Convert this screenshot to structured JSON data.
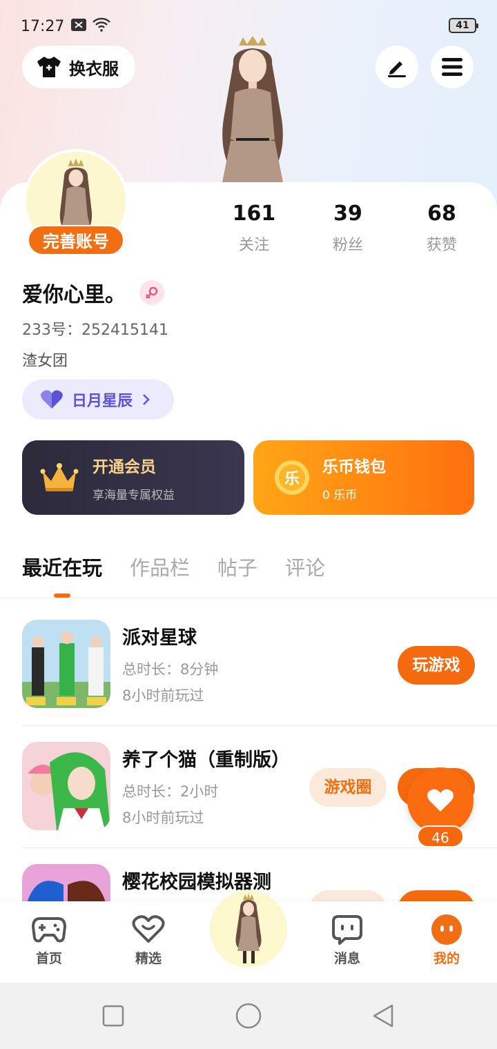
{
  "status": {
    "time": "17:27",
    "battery": "41"
  },
  "header": {
    "dress_label": "换衣服"
  },
  "profile": {
    "complete_label": "完善账号",
    "name": "爱你心里。",
    "uid_text": "233号：252415141",
    "bio": "渣女团",
    "group_label": "日月星辰"
  },
  "stats": [
    {
      "value": "161",
      "label": "关注"
    },
    {
      "value": "39",
      "label": "粉丝"
    },
    {
      "value": "68",
      "label": "获赞"
    }
  ],
  "promo": {
    "vip_title": "开通会员",
    "vip_sub": "享海量专属权益",
    "wallet_title": "乐币钱包",
    "wallet_sub": "0 乐币",
    "coin_glyph": "乐"
  },
  "tabs": [
    "最近在玩",
    "作品栏",
    "帖子",
    "评论"
  ],
  "games": [
    {
      "name": "派对星球",
      "duration": "总时长：8分钟",
      "last_played": "8小时前玩过",
      "play_label": "玩游戏"
    },
    {
      "name": "养了个猫（重制版）",
      "duration": "总时长：2小时",
      "last_played": "8小时前玩过",
      "circle_label": "游戏圈"
    },
    {
      "name": "樱花校园模拟器测"
    }
  ],
  "like_count": "46",
  "nav": {
    "home": "首页",
    "featured": "精选",
    "messages": "消息",
    "mine": "我的"
  },
  "colors": {
    "accent": "#f26e12",
    "vip_bg": "#2c2a3b",
    "group_text": "#5b52d6"
  }
}
